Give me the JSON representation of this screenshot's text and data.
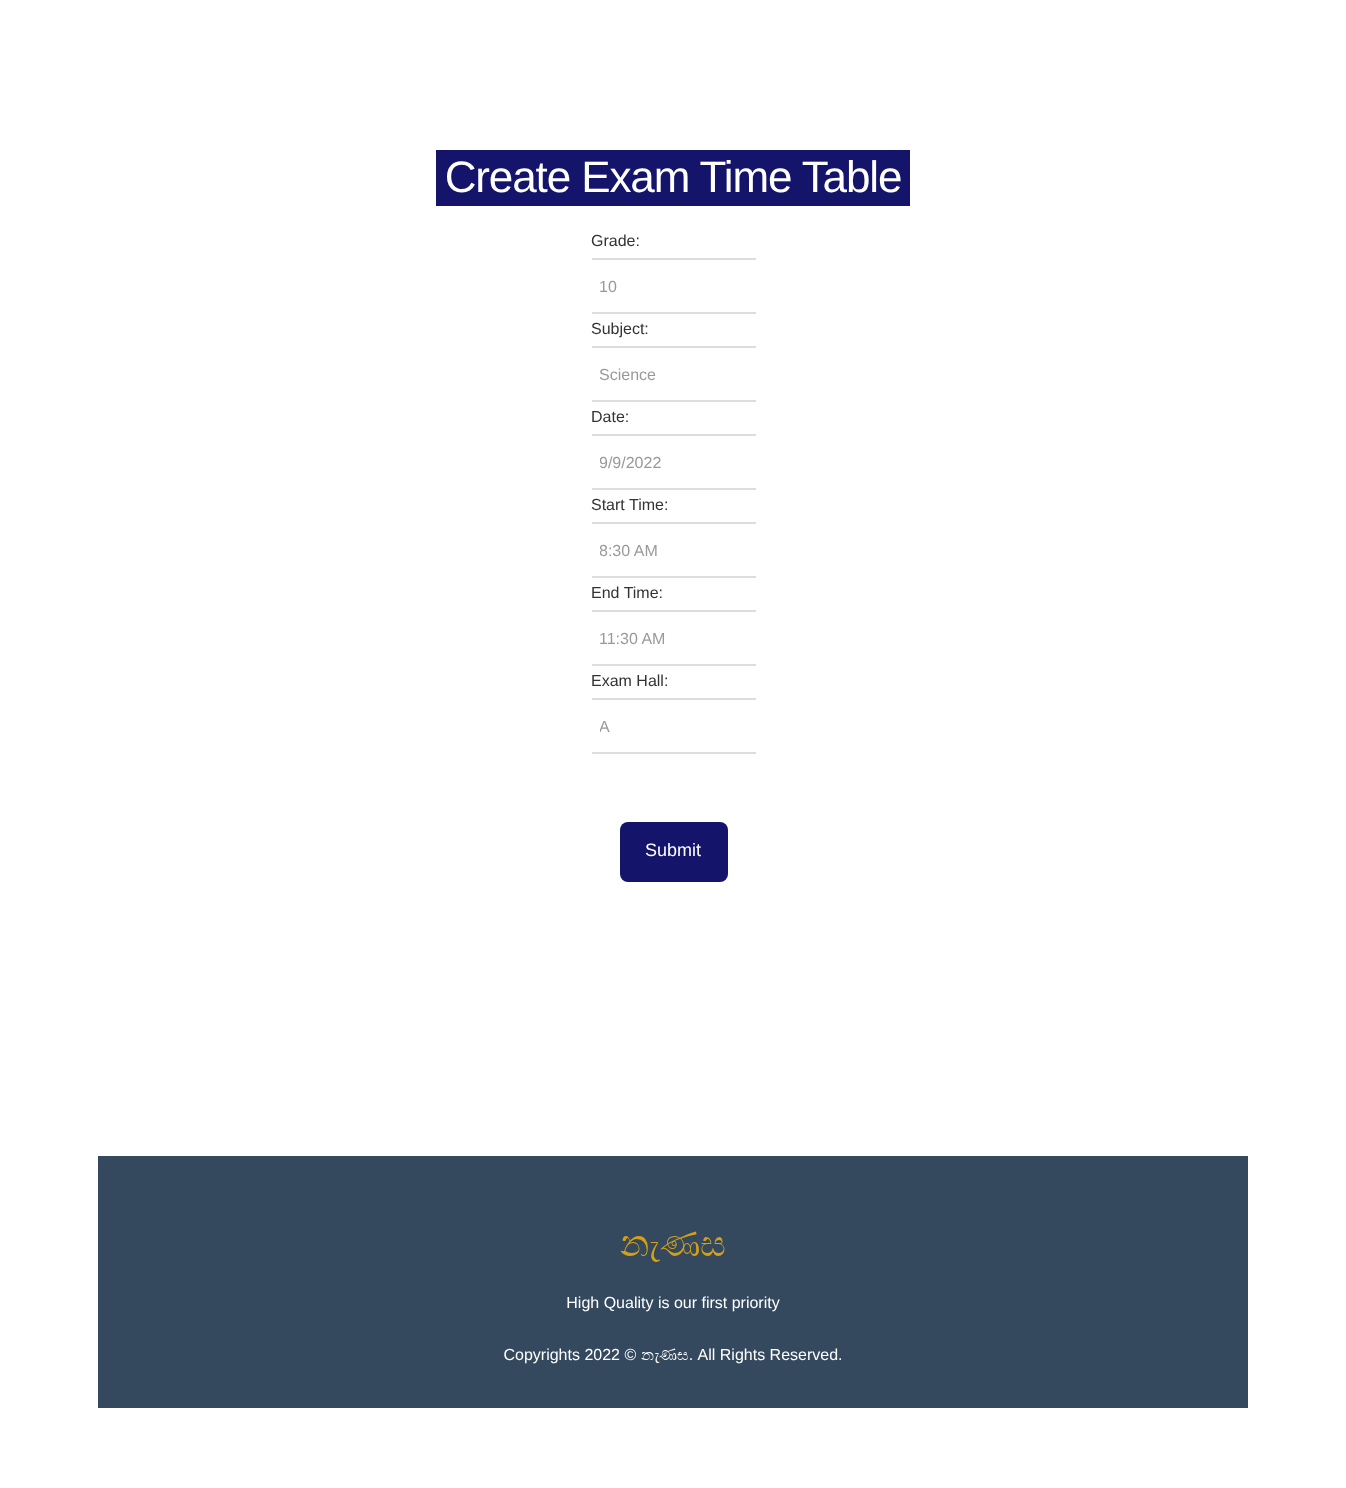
{
  "title": "Create Exam Time Table",
  "fields": [
    {
      "label": "Grade:",
      "placeholder": "10"
    },
    {
      "label": "Subject:",
      "placeholder": "Science"
    },
    {
      "label": "Date:",
      "placeholder": "9/9/2022"
    },
    {
      "label": "Start Time:",
      "placeholder": "8:30 AM"
    },
    {
      "label": "End Time:",
      "placeholder": "11:30 AM"
    },
    {
      "label": "Exam Hall:",
      "placeholder": "A"
    }
  ],
  "submit": "Submit",
  "footer": {
    "brand": "නැණස",
    "tagline": "High Quality is our first priority",
    "copyright": "Copyrights 2022 © නැණස. All Rights Reserved."
  }
}
